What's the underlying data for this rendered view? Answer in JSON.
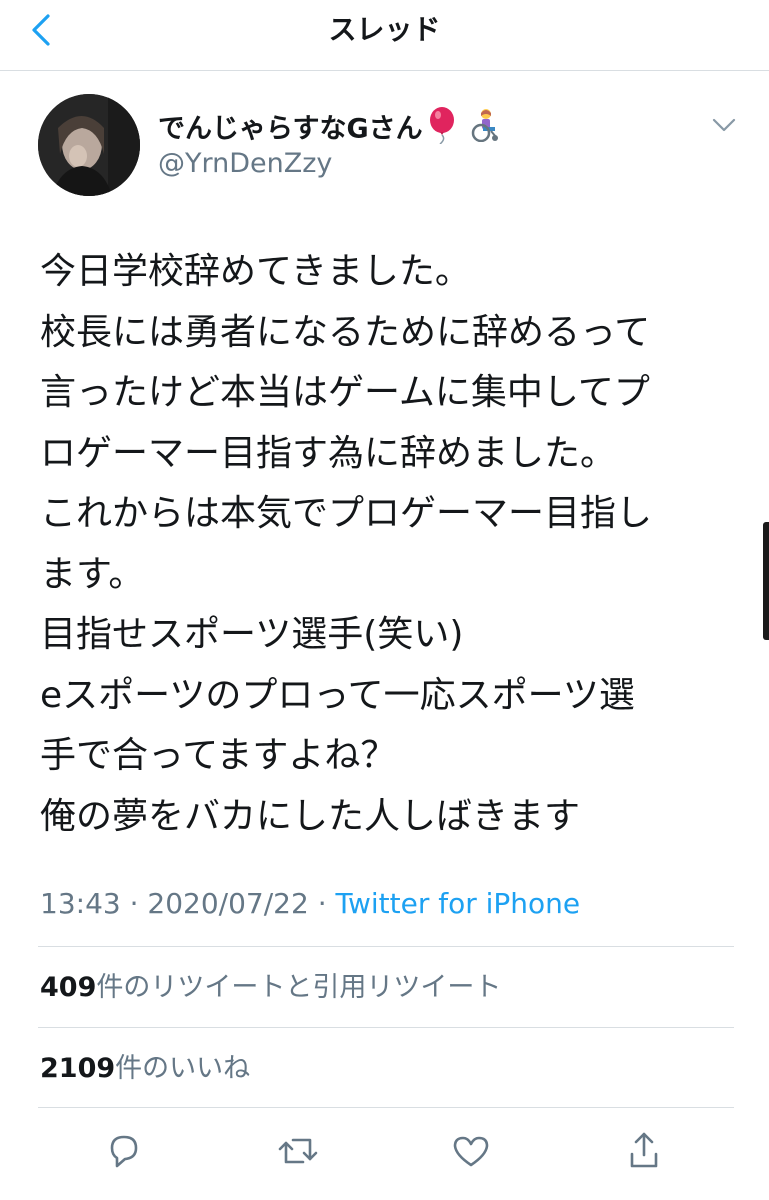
{
  "navbar": {
    "title": "スレッド",
    "back_icon": "chevron-left-icon"
  },
  "author": {
    "display_name": "でんじゃらすなGさん",
    "name_emojis": [
      "balloon-icon",
      "person-in-wheelchair-icon"
    ],
    "handle": "@YrnDenZzy"
  },
  "tweet": {
    "lines": [
      "今日学校辞めてきました。",
      "校長には勇者になるために辞めるって",
      "言ったけど本当はゲームに集中してプ",
      "ロゲーマー目指す為に辞めました。",
      "これからは本気でプロゲーマー目指し",
      "ます。",
      "目指せスポーツ選手(笑い)",
      "eスポーツのプロって一応スポーツ選",
      "手で合ってますよね？",
      "俺の夢をバカにした人しばきます"
    ],
    "time": "13:43",
    "separator": " · ",
    "date": "2020/07/22",
    "source": "Twitter for iPhone"
  },
  "stats": {
    "retweets_count": "409",
    "retweets_label": "件のリツイートと引用リツイート",
    "likes_count": "2109",
    "likes_label": "件のいいね"
  },
  "actions": [
    {
      "name": "reply-icon"
    },
    {
      "name": "retweet-icon"
    },
    {
      "name": "like-icon"
    },
    {
      "name": "share-icon"
    }
  ],
  "colors": {
    "accent": "#1da1f2",
    "text_primary": "#14171a",
    "text_secondary": "#657786",
    "divider": "#d9dee2",
    "balloon": "#e0245e"
  }
}
